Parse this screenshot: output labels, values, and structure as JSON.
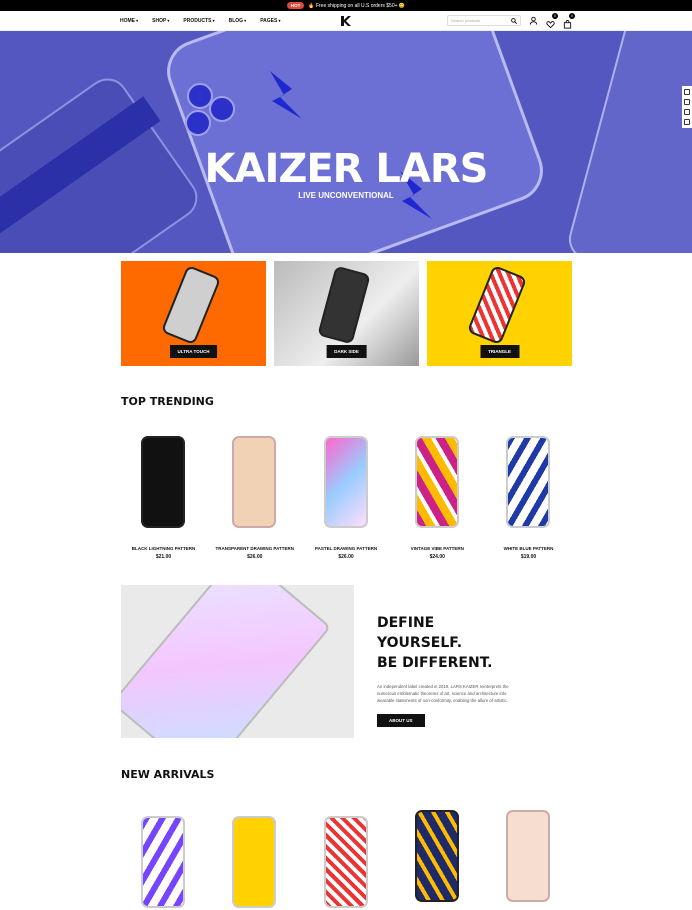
{
  "topbar": {
    "hot": "HOT",
    "text": "🔥 Free shipping on all U.S orders $50+ 😊"
  },
  "nav": {
    "items": [
      "HOME",
      "SHOP",
      "PRODUCTS",
      "BLOG",
      "PAGES"
    ],
    "search_placeholder": "Search products",
    "wishlist_count": "0",
    "cart_count": "0"
  },
  "hero": {
    "title": "KAIZER LARS",
    "subtitle": "LIVE UNCONVENTIONAL"
  },
  "categories": [
    "ULTRA TOUCH",
    "DARK SIDE",
    "TRIANGLE"
  ],
  "trending": {
    "title": "TOP TRENDING",
    "products": [
      {
        "name": "BLACK LIGHTNING PATTERN",
        "price": "$21.00"
      },
      {
        "name": "TRANSPARENT DRAWING PATTERN",
        "price": "$26.00"
      },
      {
        "name": "PASTEL DRAWING PATTERN",
        "price": "$26.00"
      },
      {
        "name": "VINTAGE VIBE PATTERN",
        "price": "$24.00"
      },
      {
        "name": "WHITE BLUE PATTERN",
        "price": "$19.00"
      }
    ]
  },
  "feature": {
    "line1": "DEFINE YOURSELF.",
    "line2": "BE DIFFERENT.",
    "body": "An independent label created in 2019, LARS KAIZER reinterprets the numerous emblematic theorems of art, science and architecture into wearable statements of non-conformity, enabling the allure of artistic.",
    "button": "ABOUT US"
  },
  "arrivals": {
    "title": "NEW ARRIVALS"
  },
  "colors": {
    "hero": "#5457c0",
    "orange": "#ff6a00",
    "yellow": "#ffd200",
    "accent": "#e0483c"
  }
}
